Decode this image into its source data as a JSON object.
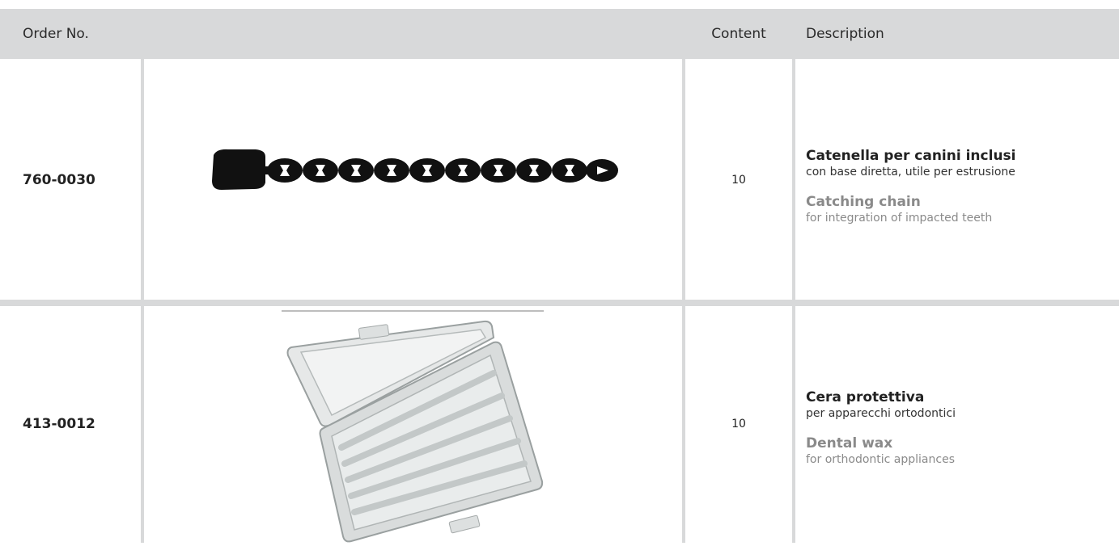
{
  "header": {
    "order_no": "Order No.",
    "image": "",
    "content": "Content",
    "description": "Description"
  },
  "rows": [
    {
      "order_no": "760-0030",
      "image_icon": "chain-icon",
      "content": "10",
      "title_it": "Catenella per canini inclusi",
      "sub_it": "con base diretta, utile per estrusione",
      "title_en": "Catching chain",
      "sub_en": "for integration of impacted teeth"
    },
    {
      "order_no": "413-0012",
      "image_icon": "wax-box-icon",
      "content": "10",
      "title_it": "Cera protettiva",
      "sub_it": "per apparecchi ortodontici",
      "title_en": "Dental wax",
      "sub_en": "for orthodontic appliances"
    }
  ],
  "colors": {
    "header_bg": "#d8d9da",
    "divider": "#d8d9da",
    "english_text": "#8a8a8a"
  }
}
